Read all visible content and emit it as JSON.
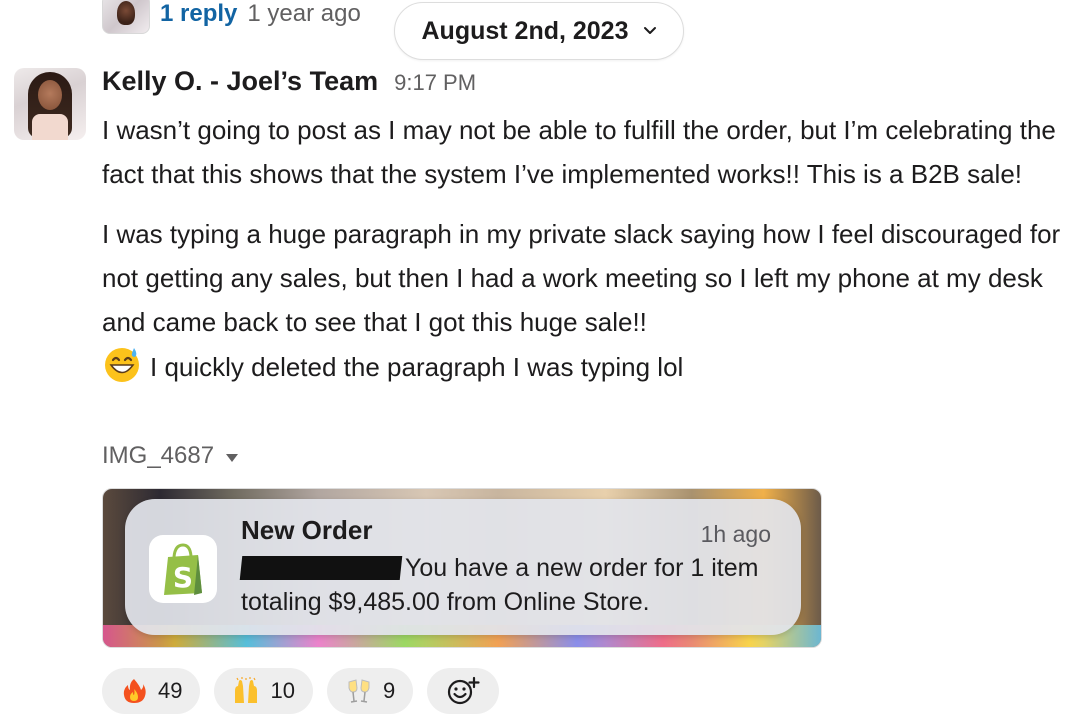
{
  "prev_message": {
    "reply_link": "1 reply",
    "reply_time": "1 year ago"
  },
  "date_divider": {
    "label": "August 2nd, 2023",
    "icon": "chevron-down-icon"
  },
  "message": {
    "sender": "Kelly O. - Joel’s Team",
    "time": "9:17 PM",
    "paragraph_1": "I wasn’t going to post as I may not be able to fulfill the order, but I’m celebrating the fact that this shows that the system I’ve implemented works!! This is a B2B sale!",
    "paragraph_2": "I was typing a huge paragraph in my private slack saying how I feel discouraged for not getting any sales, but then I had a work meeting so I left my phone at my desk and came back to see that I got this huge sale!!",
    "paragraph_2_emoji": "grinning-sweat-emoji",
    "paragraph_2_end": "I quickly deleted the paragraph I was typing lol"
  },
  "attachment": {
    "filename": "IMG_4687",
    "notification": {
      "title": "New Order",
      "time": "1h ago",
      "body": "You have a new order for 1 item totaling $9,485.00 from Online Store.",
      "app_icon": "shopify-bag-icon"
    }
  },
  "reactions": [
    {
      "emoji": "fire-emoji",
      "count": "49"
    },
    {
      "emoji": "raised-hands-emoji",
      "count": "10"
    },
    {
      "emoji": "clinking-glasses-emoji",
      "count": "9"
    }
  ],
  "add_reaction_icon": "add-reaction-icon",
  "colors": {
    "link": "#1264a3",
    "text": "#1d1c1d",
    "muted": "#616061",
    "shopify_green": "#95bf47"
  }
}
